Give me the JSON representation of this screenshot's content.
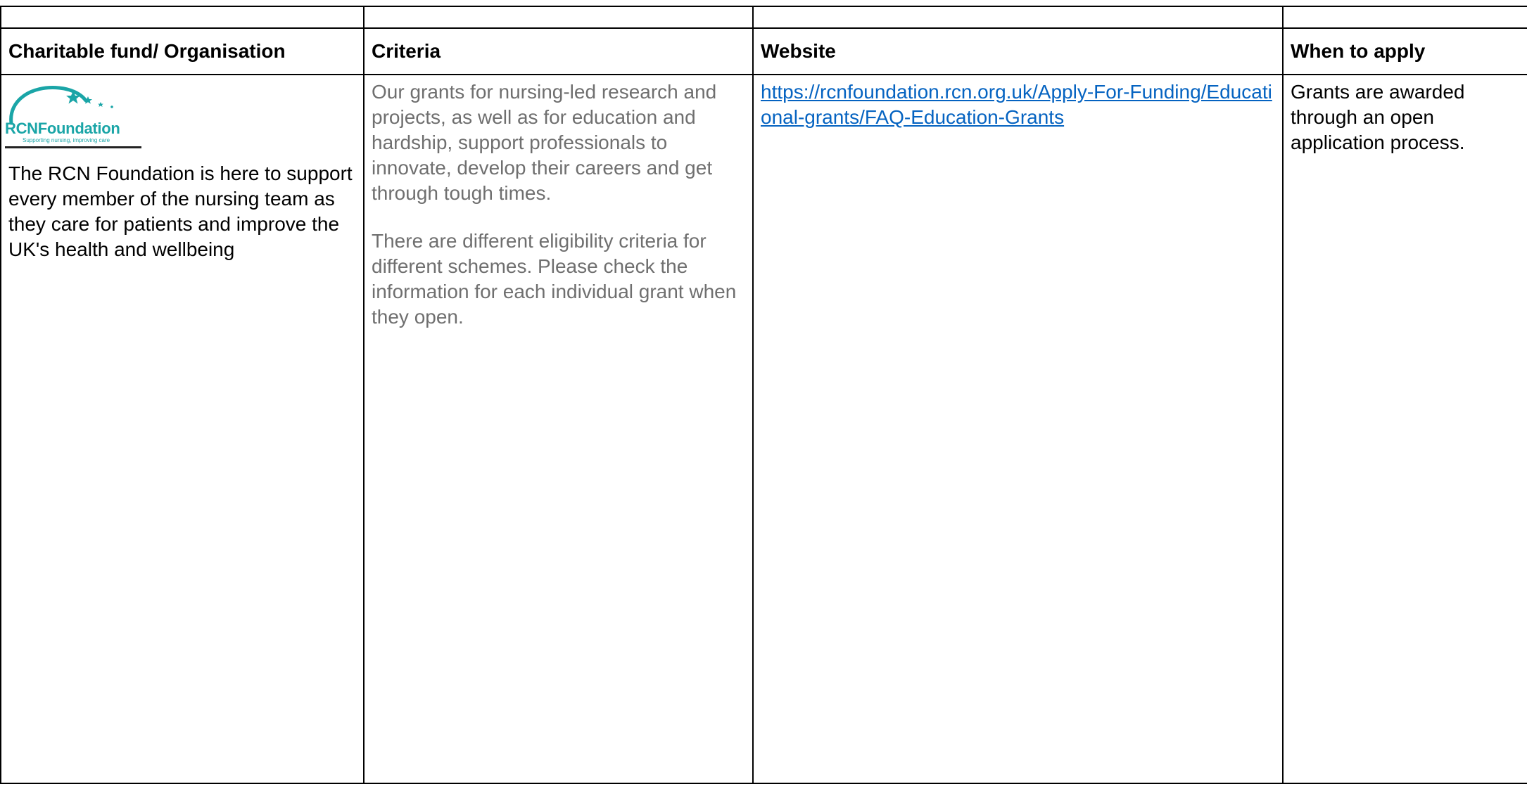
{
  "headers": {
    "organisation": "Charitable fund/ Organisation",
    "criteria": "Criteria",
    "website": "Website",
    "when_to_apply": "When to apply"
  },
  "row": {
    "logo": {
      "name": "RCNFoundation",
      "tagline": "Supporting nursing, improving care",
      "color": "#1aa5a7"
    },
    "organisation_description": "The RCN Foundation is here to support every member of the nursing team as they care for patients and improve the UK's health and wellbeing",
    "criteria_paragraphs": [
      "Our grants for nursing-led research and projects, as well as for education and hardship, support professionals to innovate, develop their careers and get through tough times.",
      "There are different eligibility criteria for different schemes. Please check the information for each individual grant when they open."
    ],
    "website_url": "https://rcnfoundation.rcn.org.uk/Apply-For-Funding/Educational-grants/FAQ-Education-Grants",
    "when_to_apply": "Grants are awarded through an open application process."
  },
  "colors": {
    "criteria_text": "#6f6f6f",
    "link": "#0563c1",
    "border": "#000000"
  }
}
